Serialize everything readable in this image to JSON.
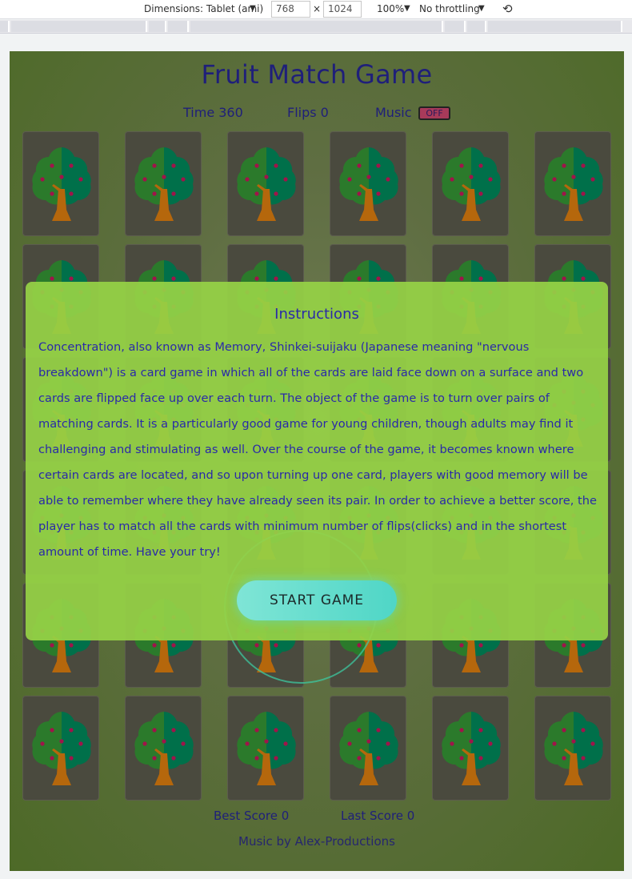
{
  "devtools": {
    "device_label": "Dimensions: Tablet (ami)",
    "width_value": "768",
    "times": "×",
    "height_value": "1024",
    "zoom": "100%",
    "throttling": "No throttling",
    "dropdown_glyph": "▼",
    "rotate_glyph": "⟲"
  },
  "game": {
    "title": "Fruit Match Game",
    "time_label": "Time 360",
    "flips_label": "Flips 0",
    "music_label": "Music",
    "music_toggle": "OFF"
  },
  "cards": {
    "rows": 6,
    "columns": 6,
    "back_icon": "tree-icon",
    "colors": {
      "card_bg": "#4a4a3e",
      "leaf_left": "#2b7a2b",
      "leaf_right": "#00704a",
      "fruit": "#a0144a",
      "trunk": "#b5670c"
    }
  },
  "instructions": {
    "title": "Instructions",
    "text": "Concentration, also known as Memory, Shinkei-suijaku (Japanese meaning \"nervous breakdown\") is a card game in which all of the cards are laid face down on a surface and two cards are flipped face up over each turn. The object of the game is to turn over pairs of matching cards. It is a particularly good game for young children, though adults may find it challenging and stimulating as well. Over the course of the game, it becomes known where certain cards are located, and so upon turning up one card, players with good memory will be able to remember where they have already seen its pair. In order to achieve a better score, the player has to match all the cards with minimum number of flips(clicks) and in the shortest amount of time. Have your try!",
    "start_button": "START GAME"
  },
  "scores": {
    "best": "Best Score 0",
    "last": "Last Score 0"
  },
  "footer": {
    "credit": "Music by Alex-Productions"
  }
}
